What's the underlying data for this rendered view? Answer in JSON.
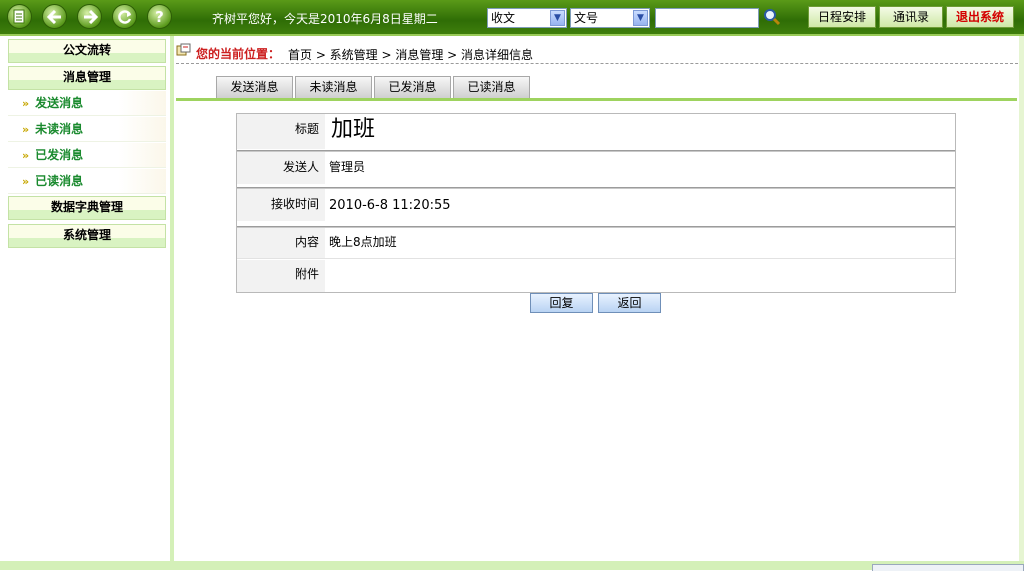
{
  "topbar": {
    "greeting": "齐树平您好，今天是2010年6月8日星期二",
    "select1_value": "收文",
    "select2_value": "文号",
    "search_value": "",
    "schedule_label": "日程安排",
    "contacts_label": "通讯录",
    "logout_label": "退出系统",
    "nav_icons": [
      "document-icon",
      "back-arrow-icon",
      "forward-arrow-icon",
      "refresh-icon",
      "help-icon"
    ],
    "accent_color": "#3f7f0c",
    "logout_color": "#d40000"
  },
  "sidebar": {
    "sections": [
      {
        "label": "公文流转"
      },
      {
        "label": "消息管理"
      },
      {
        "label": "数据字典管理"
      },
      {
        "label": "系统管理"
      }
    ],
    "items": [
      {
        "label": "发送消息"
      },
      {
        "label": "未读消息"
      },
      {
        "label": "已发消息"
      },
      {
        "label": "已读消息"
      }
    ],
    "item_bullet": "»"
  },
  "breadcrumb": {
    "label": "您的当前位置：",
    "path": "首页 > 系统管理 > 消息管理 > 消息详细信息"
  },
  "tabs": [
    {
      "label": "发送消息"
    },
    {
      "label": "未读消息"
    },
    {
      "label": "已发消息"
    },
    {
      "label": "已读消息"
    }
  ],
  "detail": {
    "title_label": "标题",
    "title_value": "加班",
    "sender_label": "发送人",
    "sender_value": "管理员",
    "time_label": "接收时间",
    "time_value": "2010-6-8 11:20:55",
    "content_label": "内容",
    "content_value": "晚上8点加班",
    "attachment_label": "附件",
    "attachment_value": ""
  },
  "actions": {
    "reply_label": "回复",
    "back_label": "返回"
  }
}
